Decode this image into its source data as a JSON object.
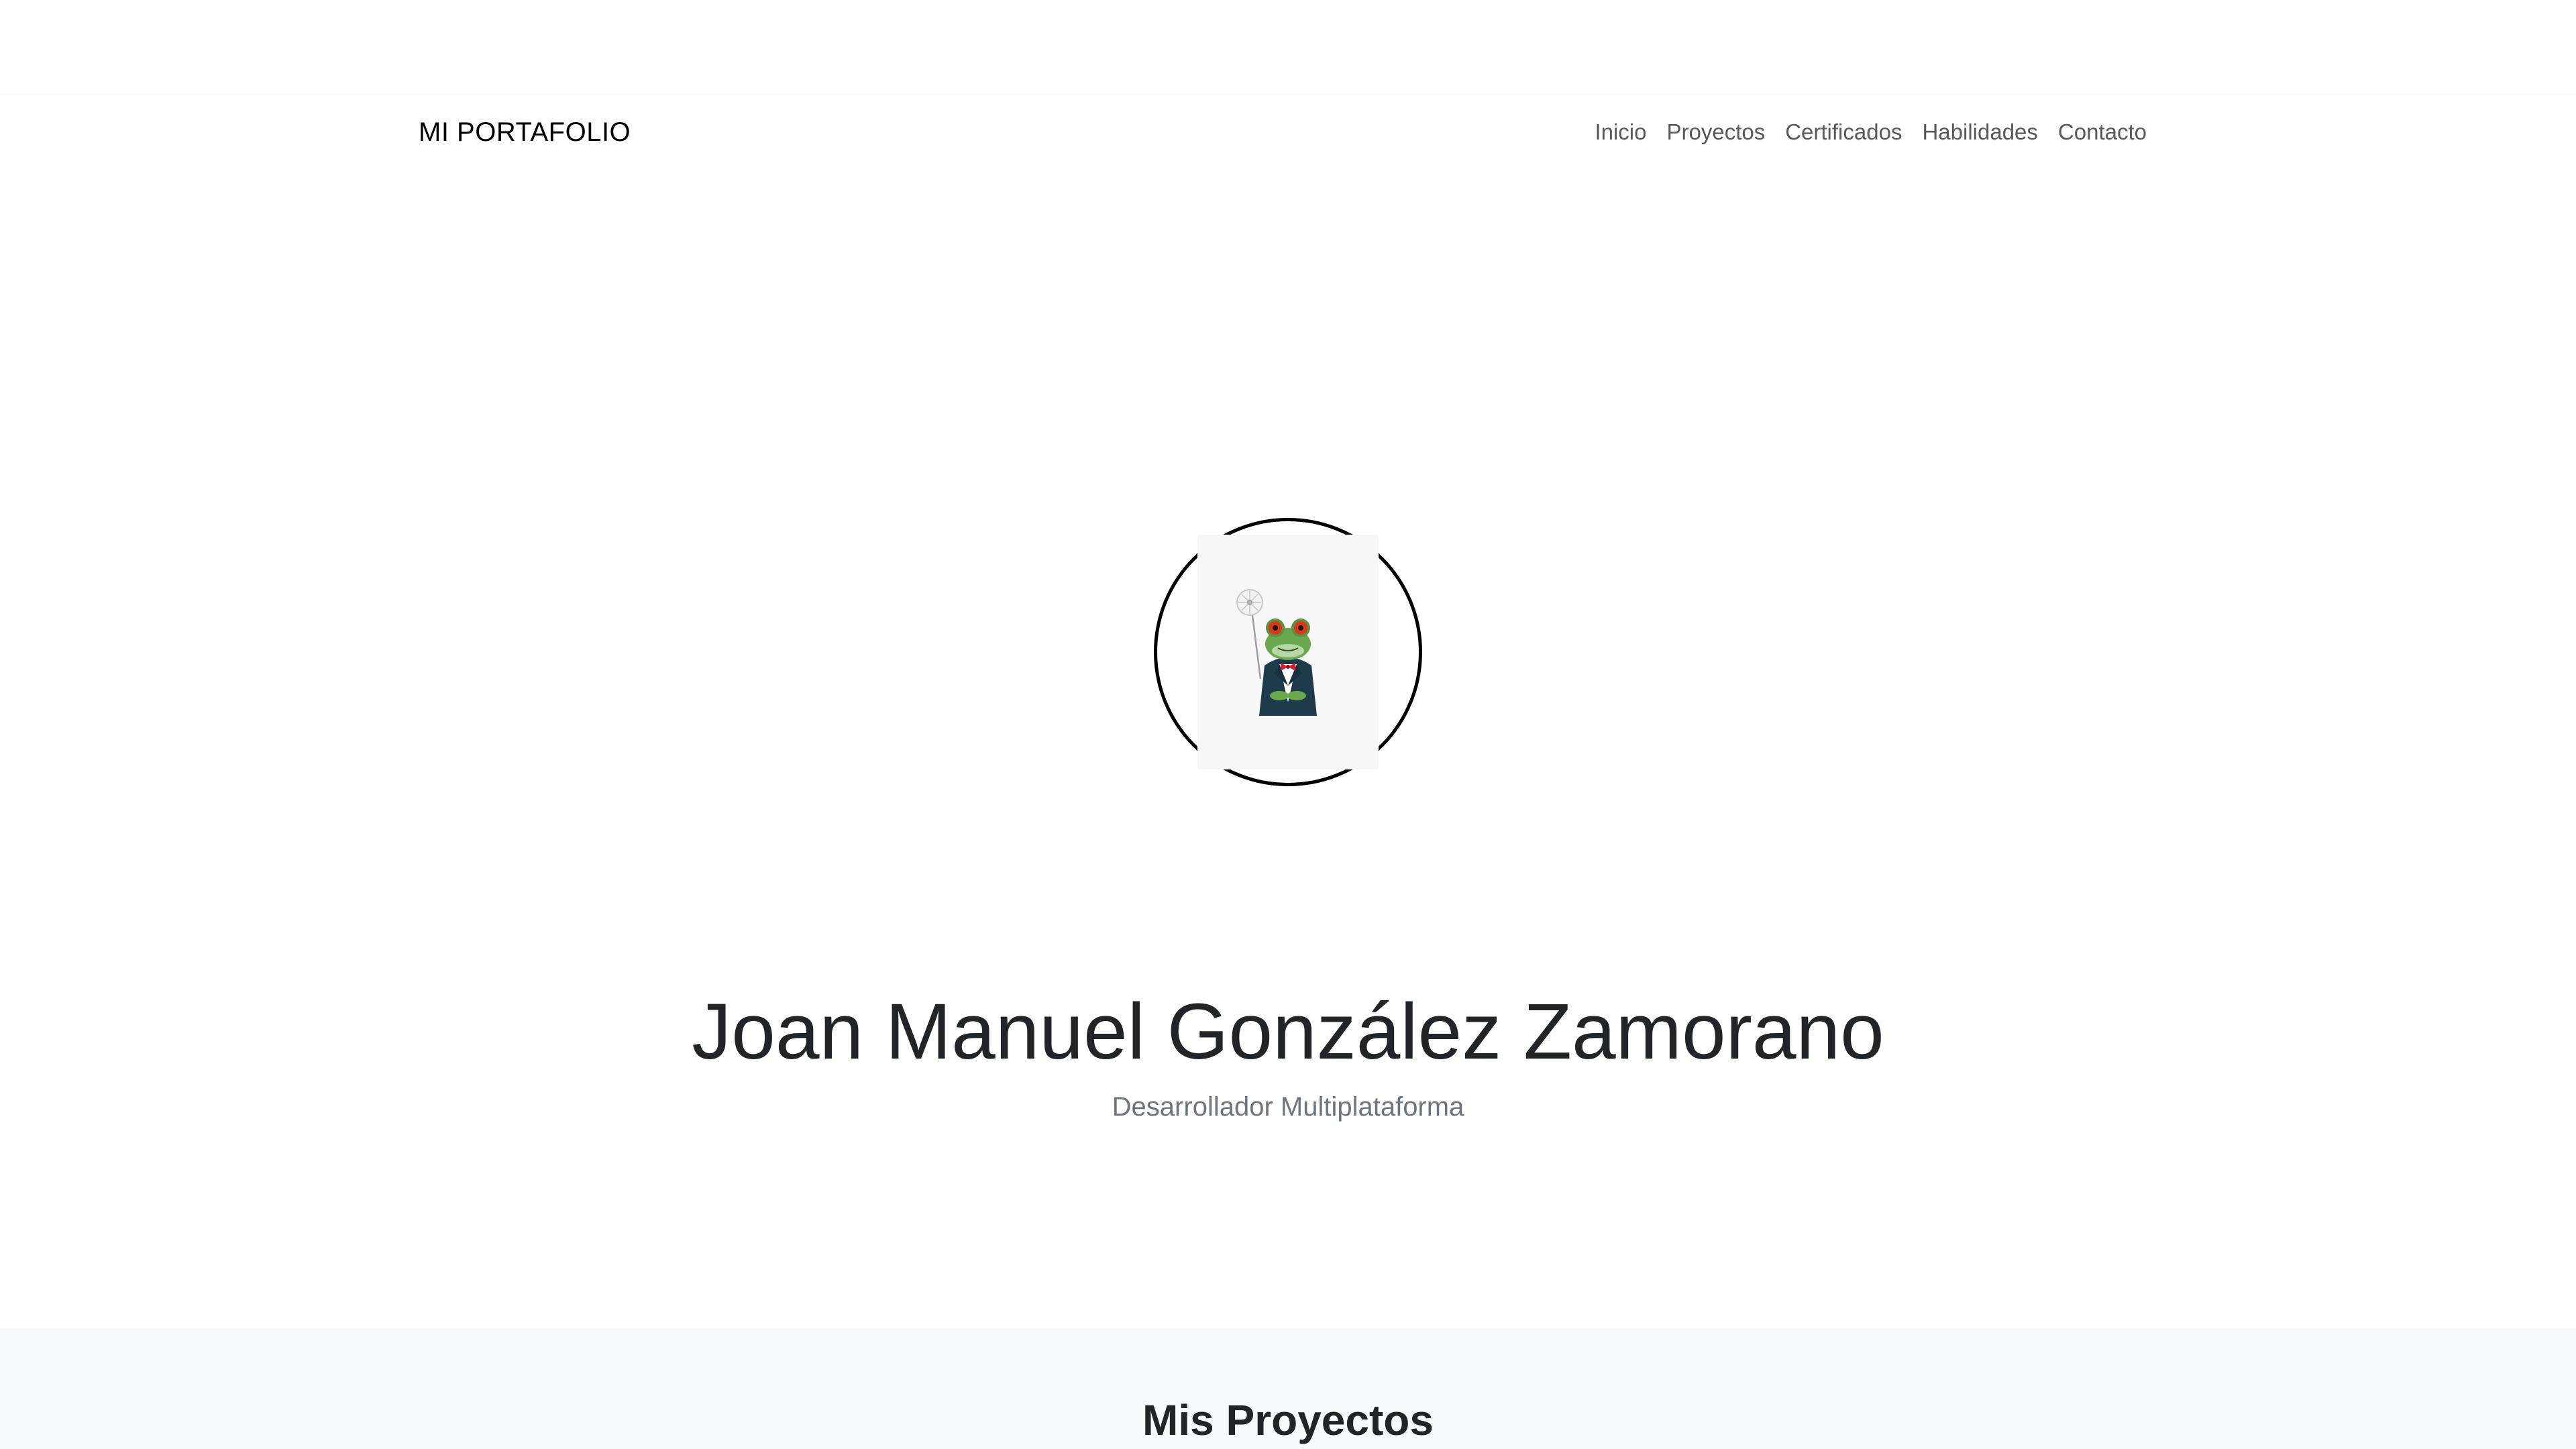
{
  "navbar": {
    "brand": "MI PORTAFOLIO",
    "links": [
      {
        "label": "Inicio"
      },
      {
        "label": "Proyectos"
      },
      {
        "label": "Certificados"
      },
      {
        "label": "Habilidades"
      },
      {
        "label": "Contacto"
      }
    ]
  },
  "hero": {
    "avatar_icon": "frog-in-tuxedo-avatar",
    "name": "Joan Manuel González Zamorano",
    "subtitle": "Desarrollador Multiplataforma"
  },
  "projects": {
    "title": "Mis Proyectos"
  },
  "colors": {
    "background": "#ffffff",
    "section_background": "#f8f9fa",
    "nav_link": "#595959",
    "text": "#212529",
    "muted": "#6c757d"
  }
}
